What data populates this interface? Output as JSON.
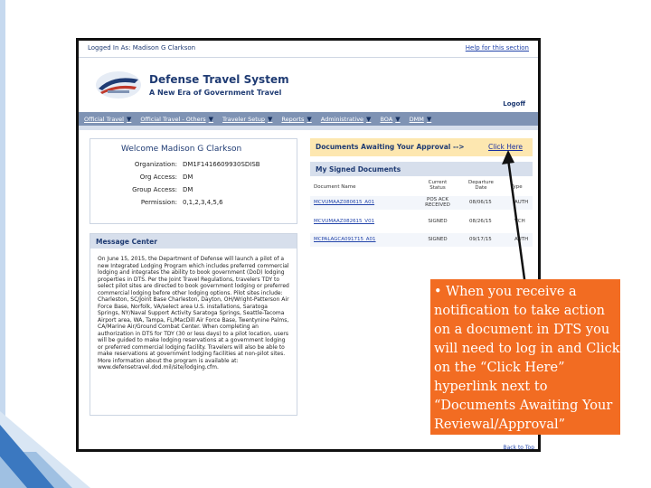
{
  "top_bar": {
    "logged_in_label": "Logged In As:",
    "user_name": "Madison G Clarkson",
    "help_link": "Help for this section"
  },
  "header": {
    "title": "Defense Travel System",
    "subtitle": "A New Era of Government Travel",
    "logoff_label": "Logoff"
  },
  "menu": {
    "items": [
      {
        "label": "Official Travel"
      },
      {
        "label": "Official Travel - Others"
      },
      {
        "label": "Traveler Setup"
      },
      {
        "label": "Reports"
      },
      {
        "label": "Administrative"
      },
      {
        "label": "BOA"
      },
      {
        "label": "DMM"
      }
    ]
  },
  "welcome": {
    "heading": "Welcome Madison G Clarkson",
    "organization_label": "Organization:",
    "organization_value": "DM1F1416609930SDISB",
    "org_access_label": "Org Access:",
    "org_access_value": "DM",
    "group_access_label": "Group Access:",
    "group_access_value": "DM",
    "permission_label": "Permission:",
    "permission_value": "0,1,2,3,4,5,6"
  },
  "message_center": {
    "heading": "Message Center",
    "body": "On June 15, 2015, the Department of Defense will launch a pilot of a new Integrated Lodging Program which includes preferred commercial lodging and integrates the ability to book government (DoD) lodging properties in DTS. Per the Joint Travel Regulations, travelers TDY to select pilot sites are directed to book government lodging or preferred commercial lodging before other lodging options. Pilot sites include: Charleston, SC/Joint Base Charleston, Dayton, OH/Wright-Patterson Air Force Base, Norfolk, VA/select area U.S. installations, Saratoga Springs, NY/Naval Support Activity Saratoga Springs, Seattle-Tacoma Airport area, WA, Tampa, FL/MacDill Air Force Base, Twentynine Palms, CA/Marine Air/Ground Combat Center. When completing an authorization in DTS for TDY (30 or less days) to a pilot location, users will be guided to make lodging reservations at a government lodging or preferred commercial lodging facility. Travelers will also be able to make reservations at government lodging facilities at non-pilot sites. More information about the program is available at:",
    "link": "www.defensetravel.dod.mil/site/lodging.cfm."
  },
  "awaiting": {
    "label": "Documents Awaiting Your Approval -->",
    "link": "Click Here"
  },
  "signed": {
    "heading": "My Signed Documents",
    "columns": {
      "doc": "Document Name",
      "status_1": "Current",
      "status_2": "Status",
      "date_1": "Departure",
      "date_2": "Date",
      "action": "Type"
    },
    "rows": [
      {
        "doc": "MCVUMAAZ080615_A01",
        "status_1": "POS ACK",
        "status_2": "RECEIVED",
        "date": "08/06/15",
        "action": "AUTH"
      },
      {
        "doc": "MCVUMAAZ082615_V01",
        "status_1": "SIGNED",
        "status_2": "",
        "date": "08/26/15",
        "action": "VCH"
      },
      {
        "doc": "MCPALAGCA091715_A01",
        "status_1": "SIGNED",
        "status_2": "",
        "date": "09/17/15",
        "action": "AUTH"
      }
    ],
    "back_to_top": "Back to Top"
  },
  "callout": {
    "text": "• When you receive a notification to take action on a document in DTS you will need to log in and Click on the “Click Here” hyperlink next to “Documents Awaiting Your Reviewal/Approval”"
  },
  "colors": {
    "callout": "#f26c22",
    "menu_bar": "#7f93b4",
    "awaiting_banner": "#fde7b0",
    "navy_text": "#1f3b73"
  }
}
